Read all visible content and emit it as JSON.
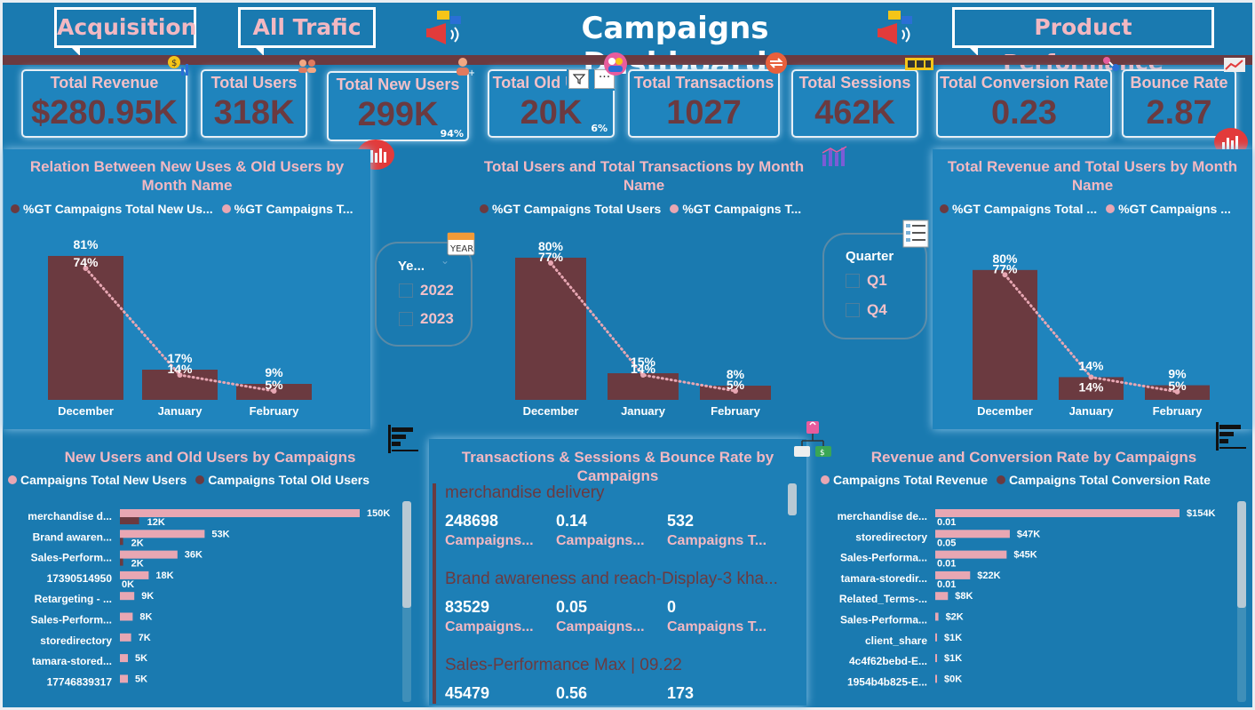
{
  "nav": {
    "acquisition": "Acquisition",
    "all_traffic": "All Trafic",
    "product_performance": "Product Performance"
  },
  "title": "Campaigns Dashboard",
  "kpis": [
    {
      "label": "Total Revenue",
      "value": "$280.95K",
      "pct": ""
    },
    {
      "label": "Total Users",
      "value": "318K",
      "pct": ""
    },
    {
      "label": "Total New Users",
      "value": "299K",
      "pct": "94%"
    },
    {
      "label": "Total Old Users",
      "value": "20K",
      "pct": "6%"
    },
    {
      "label": "Total Transactions",
      "value": "1027",
      "pct": ""
    },
    {
      "label": "Total Sessions",
      "value": "462K",
      "pct": ""
    },
    {
      "label": "Total Conversion Rate",
      "value": "0.23",
      "pct": ""
    },
    {
      "label": "Bounce Rate",
      "value": "2.87",
      "pct": ""
    }
  ],
  "visual_header": {
    "filter_icon": "filter-icon",
    "more_icon": "more-options-icon"
  },
  "slicers": {
    "year": {
      "header": "Ye...",
      "options": [
        "2022",
        "2023"
      ]
    },
    "quarter": {
      "header": "Quarter",
      "options": [
        "Q1",
        "Q4"
      ]
    }
  },
  "chart_data": [
    {
      "type": "bar",
      "title": "Relation Between New Uses & Old Users by Month Name",
      "legend": [
        "%GT Campaigns Total New Us...",
        "%GT Campaigns T..."
      ],
      "categories": [
        "December",
        "January",
        "February"
      ],
      "series": [
        {
          "name": "%GT Campaigns Total New Us...",
          "kind": "bar",
          "values": [
            81,
            17,
            9
          ],
          "labels": [
            "81%",
            "17%",
            "9%"
          ]
        },
        {
          "name": "%GT Campaigns T...",
          "kind": "line",
          "values": [
            74,
            14,
            5
          ],
          "labels": [
            "74%",
            "14%",
            "5%"
          ]
        }
      ]
    },
    {
      "type": "bar",
      "title": "Total Users and Total Transactions by Month Name",
      "legend": [
        "%GT Campaigns Total Users",
        "%GT Campaigns T..."
      ],
      "categories": [
        "December",
        "January",
        "February"
      ],
      "series": [
        {
          "name": "%GT Campaigns Total Users",
          "kind": "bar",
          "values": [
            80,
            15,
            8
          ],
          "labels": [
            "80%",
            "15%",
            "8%"
          ]
        },
        {
          "name": "%GT Campaigns T...",
          "kind": "line",
          "values": [
            77,
            14,
            5
          ],
          "labels": [
            "77%",
            "14%",
            "5%"
          ]
        }
      ]
    },
    {
      "type": "bar",
      "title": "Total Revenue and Total Users by Month Name",
      "legend": [
        "%GT Campaigns Total ...",
        "%GT Campaigns ..."
      ],
      "categories": [
        "December",
        "January",
        "February"
      ],
      "series": [
        {
          "name": "%GT Campaigns Total ...",
          "kind": "bar",
          "values": [
            80,
            14,
            9
          ],
          "labels": [
            "80%",
            "14%",
            "9%"
          ]
        },
        {
          "name": "%GT Campaigns ...",
          "kind": "line",
          "values": [
            77,
            14,
            5
          ],
          "labels": [
            "77%",
            "14%",
            "5%"
          ]
        }
      ]
    },
    {
      "type": "bar",
      "orientation": "horizontal",
      "title": "New Users and Old Users by Campaigns",
      "legend": [
        "Campaigns Total New Users",
        "Campaigns Total Old Users"
      ],
      "categories": [
        "merchandise d...",
        "Brand awaren...",
        "Sales-Perform...",
        "17390514950",
        "Retargeting - ...",
        "Sales-Perform...",
        "storedirectory",
        "tamara-stored...",
        "17746839317"
      ],
      "series": [
        {
          "name": "Campaigns Total New Users",
          "values": [
            150,
            53,
            36,
            18,
            9,
            8,
            7,
            5,
            5
          ],
          "labels": [
            "150K",
            "53K",
            "36K",
            "18K",
            "9K",
            "8K",
            "7K",
            "5K",
            "5K"
          ]
        },
        {
          "name": "Campaigns Total Old Users",
          "values": [
            12,
            2,
            2,
            0,
            null,
            null,
            null,
            null,
            null
          ],
          "labels": [
            "12K",
            "2K",
            "2K",
            "0K",
            "",
            "",
            "",
            "",
            ""
          ]
        }
      ]
    },
    {
      "type": "bar",
      "orientation": "horizontal",
      "title": "Revenue and Conversion Rate by Campaigns",
      "legend": [
        "Campaigns Total Revenue",
        "Campaigns Total Conversion Rate"
      ],
      "categories": [
        "merchandise de...",
        "storedirectory",
        "Sales-Performa...",
        "tamara-storedir...",
        "Related_Terms-...",
        "Sales-Performa...",
        "client_share",
        "4c4f62bebd-E...",
        "1954b4b825-E..."
      ],
      "series": [
        {
          "name": "Campaigns Total Revenue",
          "values": [
            154,
            47,
            45,
            22,
            8,
            2,
            1,
            1,
            0
          ],
          "labels": [
            "$154K",
            "$47K",
            "$45K",
            "$22K",
            "$8K",
            "$2K",
            "$1K",
            "$1K",
            "$0K"
          ]
        },
        {
          "name": "Campaigns Total Conversion Rate",
          "values": [
            0.01,
            0.05,
            0.01,
            0.01,
            null,
            null,
            null,
            null,
            null
          ],
          "labels": [
            "0.01",
            "0.05",
            "0.01",
            "0.01",
            "",
            "",
            "",
            "",
            ""
          ]
        }
      ]
    }
  ],
  "cards": {
    "title": "Transactions & Sessions & Bounce Rate by Campaigns",
    "items": [
      {
        "name": "merchandise delivery",
        "values": [
          "248698",
          "0.14",
          "532"
        ],
        "labels": [
          "Campaigns...",
          "Campaigns...",
          "Campaigns T..."
        ]
      },
      {
        "name": "Brand awareness and reach-Display-3 kha...",
        "values": [
          "83529",
          "0.05",
          "0"
        ],
        "labels": [
          "Campaigns...",
          "Campaigns...",
          "Campaigns T..."
        ]
      },
      {
        "name": "Sales-Performance Max | 09.22",
        "values": [
          "45479",
          "0.56",
          "173"
        ],
        "labels": [
          "",
          "",
          ""
        ]
      }
    ]
  },
  "icons": {
    "megaphone_left": "megaphone-icon",
    "megaphone_right": "megaphone-icon",
    "revenue": "money-chart-icon",
    "users": "users-icon",
    "new_user": "add-user-icon",
    "old_users": "old-users-icon",
    "transactions": "transaction-icon",
    "sessions": "session-icon",
    "conversion": "conversion-icon",
    "bounce": "bounce-chart-icon",
    "calendar": "calendar-icon",
    "list": "list-icon",
    "shop": "shopping-network-icon"
  }
}
